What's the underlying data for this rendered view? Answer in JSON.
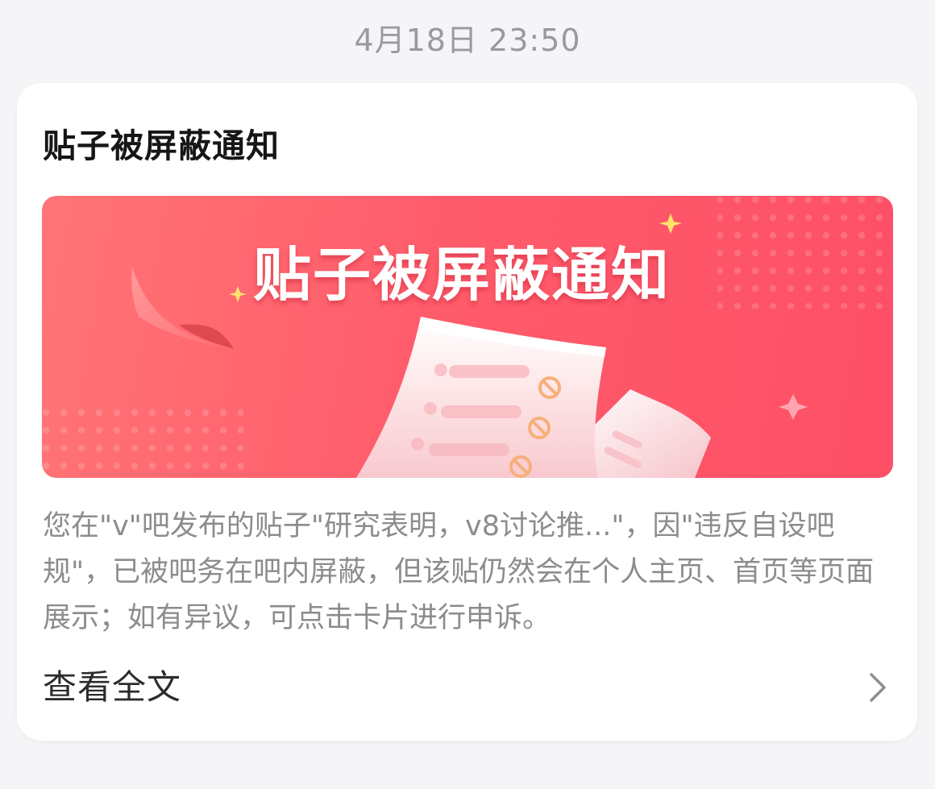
{
  "timestamp": "4月18日 23:50",
  "card": {
    "title": "贴子被屏蔽通知",
    "banner": {
      "title": "贴子被屏蔽通知",
      "image": "document-blocked-illustration"
    },
    "body": "您在\"v\"吧发布的贴子\"研究表明，v8讨论推...\"，因\"违反自设吧规\"，已被吧务在吧内屏蔽，但该贴仍然会在个人主页、首页等页面展示；如有异议，可点击卡片进行申诉。",
    "footer": {
      "label": "查看全文",
      "icon": "chevron-right-icon"
    }
  },
  "colors": {
    "background": "#f5f5f7",
    "banner_red": "#fd5667",
    "text_gray": "#8c8c8f",
    "title_black": "#161616"
  }
}
